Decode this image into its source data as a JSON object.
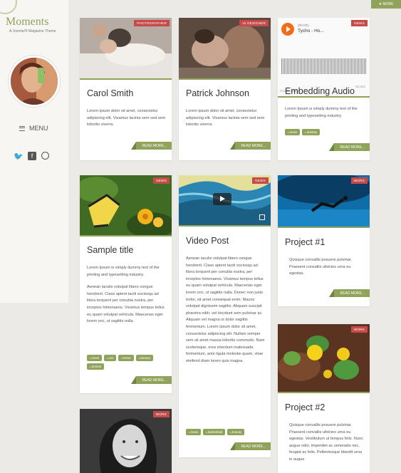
{
  "sidebar": {
    "logo": "Moments",
    "tagline": "A Joomla!® Magazine Theme",
    "menu_label": "MENU"
  },
  "top_more": "★ MORE",
  "cards": {
    "carol": {
      "badge": "PHOTOGRAPHER",
      "title": "Carol Smith",
      "body": "Lorem ipsum dolor sit amet, consectetur adipiscing elit. Vivamus lacinia sem sed sem lobortis viverra.",
      "readmore": "READ MORE..."
    },
    "patrick": {
      "badge": "UI DESIGNER",
      "title": "Patrick Johnson",
      "body": "Lorem ipsum dolor sit amet, consectetur adipiscing elit. Vivamus lacinia sem sed sem lobortis viverra.",
      "readmore": "READ MORE..."
    },
    "audio": {
      "badge": "NEWS",
      "artist": "ghostly",
      "track": "Tycho - Ho...",
      "cookie": "Cookie policy",
      "plays": "54,241",
      "title": "Embedding Audio",
      "body": "Lorem Ipsum is simply dummy text of the printing and typesetting industry.",
      "tags": [
        "news",
        "donkey"
      ],
      "readmore": "READ MORE..."
    },
    "sample": {
      "badge": "NEWS",
      "title": "Sample title",
      "p1": "Lorem Ipsum is simply dummy text of the printing and typesetting industry.",
      "p2": "Aenean iaculis volutpat libero congue hendrerit. Class aptent taciti sociosqu ad litora torquent per conubia nostra, per inceptos himenaeos. Vivamus tempus tellus eu quam volutpat vehicula. Maecenas eget lorem orci, ut sagittis nulla.",
      "tags": [
        "news",
        "cat",
        "home",
        "beauty",
        "animal"
      ],
      "readmore": "READ MORE..."
    },
    "video": {
      "badge": "NEWS",
      "title": "Video Post",
      "body": "Aenean iaculis volutpat libero congue hendrerit. Class aptent taciti sociosqu ad litora torquent per conubia nostra, per inceptos himenaeos. Vivamus tempus tellus eu quam volutpat vehicula. Maecenas eget lorem orci, ut sagittis nulla. Donec non justo tortor, sit amet consequat enim. Mauris volutpat dignissim sagittis. Aliquam suscipit pharetra nibh, vel tincidunt sem pulvinar ac. Aliquam vel magna ut dolor sagittis fermentum. Lorem ipsum dolor sit amet, consectetur adipiscing elit. Nullam semper sem sit amet massa lobortis commodo. Nam scelerisque, eros interdum malesuada fermentum, ante ligula molestie quam, vitae eleifend diam lorem quis magna.",
      "tags": [
        "news",
        "basketball",
        "beauty"
      ],
      "readmore": "READ MORE..."
    },
    "project1": {
      "badge": "WORK",
      "title": "Project #1",
      "body": "Quisque convallis posuere pulvinar. Praesent convallis ultricies urna eu egestas.",
      "readmore": "READ MORE..."
    },
    "project2": {
      "badge": "WORK",
      "title": "Project #2",
      "body": "Quisque convallis posuere pulvinar. Praesent convallis ultricies urna eu egestas. Vestibulum ut tempus felis. Nunc augue odio, imperdiet ac venenatis nec, feugiat ac felis. Pellentesque blandit urna in augue"
    },
    "woman": {
      "badge": "WORK"
    }
  },
  "colors": {
    "accent": "#8fa35a",
    "badge": "#c54b4b",
    "background": "#eceae6"
  }
}
